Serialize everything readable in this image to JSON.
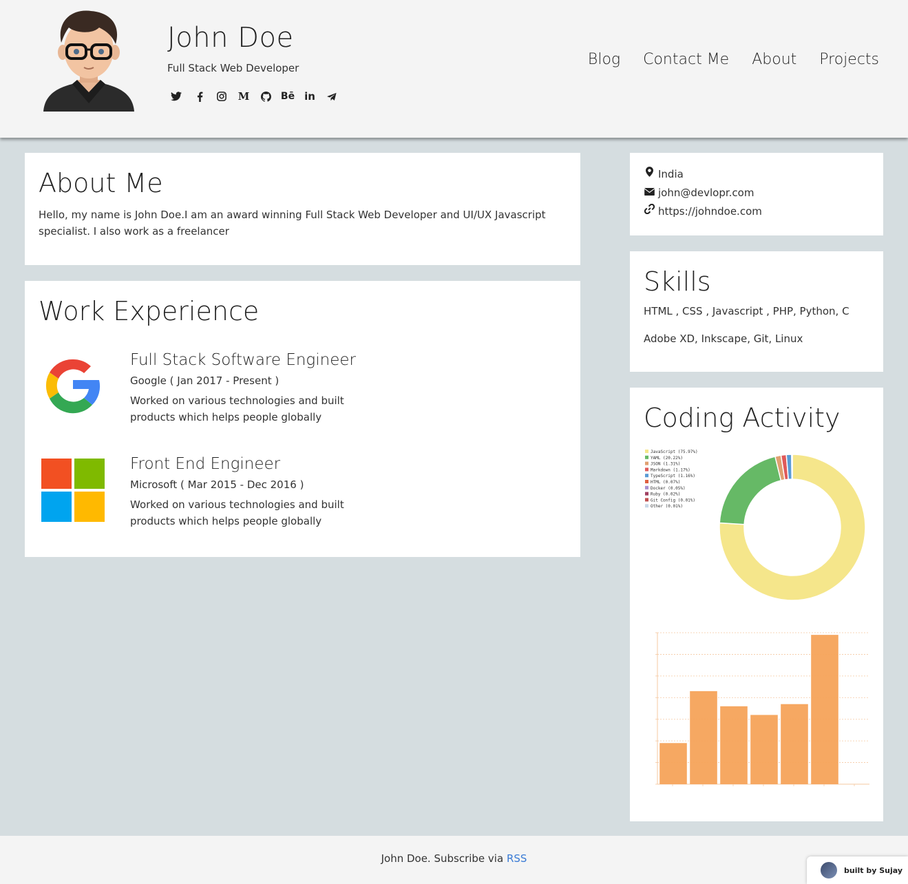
{
  "header": {
    "name": "John Doe",
    "tagline": "Full Stack Web Developer",
    "socials": [
      {
        "icon": "twitter-icon",
        "glyph": "🐦"
      },
      {
        "icon": "facebook-icon",
        "glyph": "f"
      },
      {
        "icon": "instagram-icon",
        "glyph": "◎"
      },
      {
        "icon": "medium-icon",
        "glyph": "M"
      },
      {
        "icon": "github-icon",
        "glyph": "●"
      },
      {
        "icon": "behance-icon",
        "glyph": "Bē"
      },
      {
        "icon": "linkedin-icon",
        "glyph": "in"
      },
      {
        "icon": "telegram-icon",
        "glyph": "➤"
      }
    ],
    "nav": [
      "Blog",
      "Contact Me",
      "About",
      "Projects"
    ]
  },
  "about": {
    "heading": "About Me",
    "text": "Hello, my name is John Doe.I am an award winning Full Stack Web Developer and UI/UX Javascript specialist. I also work as a freelancer"
  },
  "work": {
    "heading": "Work Experience",
    "jobs": [
      {
        "title": "Full Stack Software Engineer",
        "company": "Google ( Jan 2017 - Present )",
        "desc": "Worked on various technologies and built products which helps people globally"
      },
      {
        "title": "Front End Engineer",
        "company": "Microsoft ( Mar 2015 - Dec 2016 )",
        "desc": "Worked on various technologies and built products which helps people globally"
      }
    ]
  },
  "contact": {
    "location": "India",
    "email": "john@devlopr.com",
    "website": "https://johndoe.com"
  },
  "skills": {
    "heading": "Skills",
    "line1": "HTML , CSS , Javascript , PHP, Python, C",
    "line2": "Adobe XD, Inkscape, Git, Linux"
  },
  "activity": {
    "heading": "Coding Activity"
  },
  "chart_data": [
    {
      "type": "pie",
      "categories": [
        "JavaScript (75.97%)",
        "YAML (20.22%)",
        "JSON (1.31%)",
        "Markdown (1.17%)",
        "TypeScript (1.16%)",
        "HTML (0.07%)",
        "Docker (0.05%)",
        "Ruby (0.02%)",
        "Git Config (0.01%)",
        "Other (0.01%)"
      ],
      "values": [
        75.97,
        20.22,
        1.31,
        1.17,
        1.16,
        0.07,
        0.05,
        0.02,
        0.01,
        0.01
      ],
      "colors": [
        "#f5e68b",
        "#66b966",
        "#e0a070",
        "#e05a5a",
        "#5a9bd5",
        "#e06040",
        "#a890d0",
        "#a04060",
        "#c05050",
        "#c8d8e8"
      ],
      "legend": "top-left"
    },
    {
      "type": "bar",
      "categories": [
        "",
        "",
        "",
        "",
        "",
        "",
        ""
      ],
      "values": [
        1.9,
        4.3,
        3.6,
        3.2,
        3.7,
        6.9,
        0
      ],
      "color": "#f5a35a",
      "grid": true
    }
  ],
  "footer": {
    "text": "John Doe. Subscribe via ",
    "link": "RSS",
    "badge": "built by Sujay"
  }
}
